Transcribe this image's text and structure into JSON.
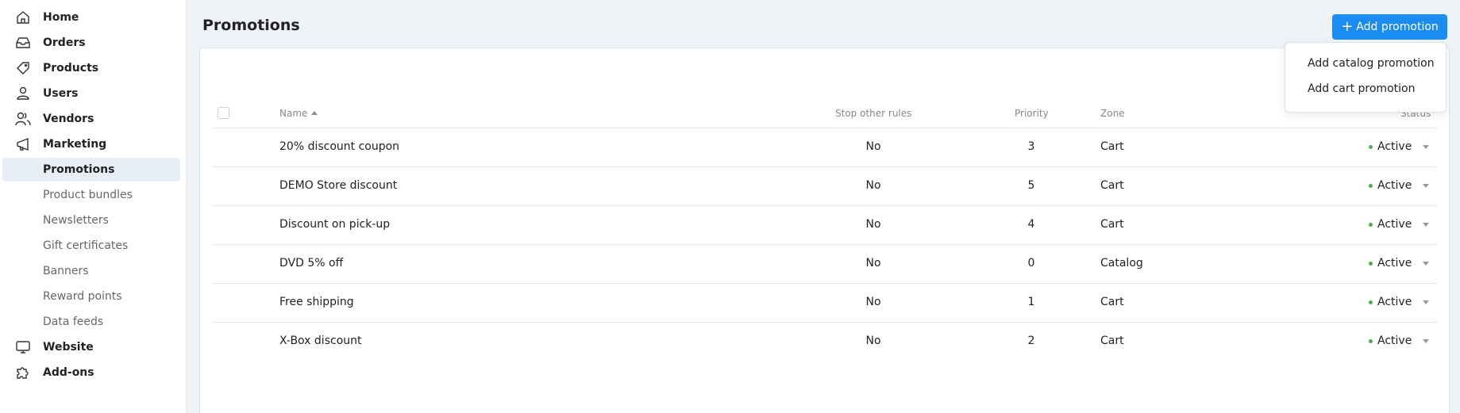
{
  "sidebar": {
    "items": [
      {
        "label": "Home",
        "icon": "home-icon",
        "type": "top"
      },
      {
        "label": "Orders",
        "icon": "inbox-icon",
        "type": "top"
      },
      {
        "label": "Products",
        "icon": "tag-icon",
        "type": "top"
      },
      {
        "label": "Users",
        "icon": "user-icon",
        "type": "top"
      },
      {
        "label": "Vendors",
        "icon": "users-icon",
        "type": "top"
      },
      {
        "label": "Marketing",
        "icon": "megaphone-icon",
        "type": "top"
      },
      {
        "label": "Promotions",
        "type": "sub",
        "active": true
      },
      {
        "label": "Product bundles",
        "type": "sub"
      },
      {
        "label": "Newsletters",
        "type": "sub"
      },
      {
        "label": "Gift certificates",
        "type": "sub"
      },
      {
        "label": "Banners",
        "type": "sub"
      },
      {
        "label": "Reward points",
        "type": "sub"
      },
      {
        "label": "Data feeds",
        "type": "sub"
      },
      {
        "label": "Website",
        "icon": "monitor-icon",
        "type": "top"
      },
      {
        "label": "Add-ons",
        "icon": "puzzle-icon",
        "type": "top"
      }
    ]
  },
  "header": {
    "title": "Promotions",
    "add_button": {
      "plus": "+",
      "label": "Add promotion"
    }
  },
  "dropdown": {
    "items": [
      "Add catalog promotion",
      "Add cart promotion"
    ]
  },
  "table": {
    "columns": {
      "name": "Name",
      "stop": "Stop other rules",
      "priority": "Priority",
      "zone": "Zone",
      "status": "Status"
    },
    "rows": [
      {
        "name": "20% discount coupon",
        "stop": "No",
        "priority": "3",
        "zone": "Cart",
        "status": "Active"
      },
      {
        "name": "DEMO Store discount",
        "stop": "No",
        "priority": "5",
        "zone": "Cart",
        "status": "Active"
      },
      {
        "name": "Discount on pick-up",
        "stop": "No",
        "priority": "4",
        "zone": "Cart",
        "status": "Active"
      },
      {
        "name": "DVD 5% off",
        "stop": "No",
        "priority": "0",
        "zone": "Catalog",
        "status": "Active"
      },
      {
        "name": "Free shipping",
        "stop": "No",
        "priority": "1",
        "zone": "Cart",
        "status": "Active"
      },
      {
        "name": "X-Box discount",
        "stop": "No",
        "priority": "2",
        "zone": "Cart",
        "status": "Active"
      }
    ]
  },
  "colors": {
    "accent": "#1a8cf2",
    "status_active": "#4caf50"
  }
}
